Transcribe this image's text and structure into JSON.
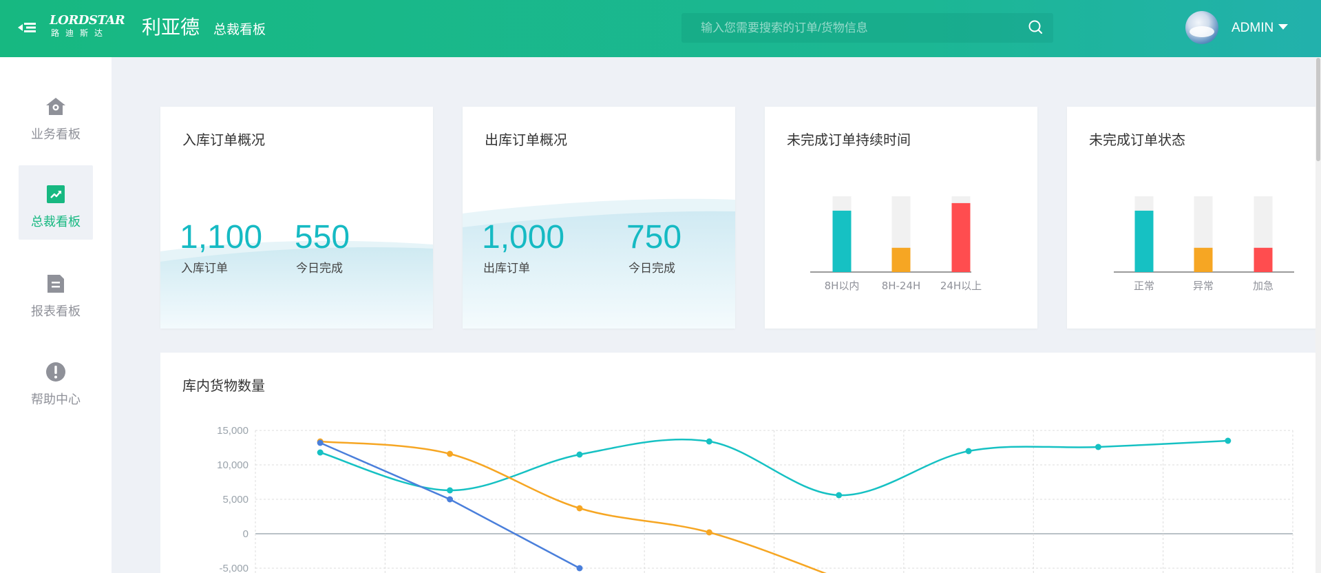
{
  "header": {
    "logo_en": "LORDSTAR",
    "logo_cn": "路迪斯达",
    "brand": "利亚德",
    "subtitle": "总裁看板",
    "search_placeholder": "输入您需要搜索的订单/货物信息",
    "user": "ADMIN"
  },
  "sidebar": {
    "items": [
      {
        "label": "业务看板",
        "icon": "home-location-icon",
        "active": false
      },
      {
        "label": "总裁看板",
        "icon": "trend-chart-icon",
        "active": true
      },
      {
        "label": "报表看板",
        "icon": "report-icon",
        "active": false
      },
      {
        "label": "帮助中心",
        "icon": "help-icon",
        "active": false
      }
    ]
  },
  "cards": {
    "inbound": {
      "title": "入库订单概况",
      "total": "1,100",
      "total_label": "入库订单",
      "today": "550",
      "today_label": "今日完成"
    },
    "outbound": {
      "title": "出库订单概况",
      "total": "1,000",
      "total_label": "出库订单",
      "today": "750",
      "today_label": "今日完成"
    },
    "duration": {
      "title": "未完成订单持续时间"
    },
    "status": {
      "title": "未完成订单状态"
    }
  },
  "colors": {
    "primary": "#17b881",
    "teal": "#16c1c3",
    "orange": "#f6a623",
    "red": "#ff4d4f",
    "blue": "#4a7fdb",
    "track": "#f1f1f1"
  },
  "chart_data": [
    {
      "type": "bar",
      "title": "",
      "categories": [
        "8H以内",
        "8H-24H",
        "24H以上"
      ],
      "values": [
        0.81,
        0.32,
        0.91
      ],
      "colors": [
        "#16c1c3",
        "#f6a623",
        "#ff4d4f"
      ],
      "ylim": [
        0,
        1
      ],
      "grid": false
    },
    {
      "type": "bar",
      "title": "",
      "categories": [
        "正常",
        "异常",
        "加急"
      ],
      "values": [
        0.81,
        0.32,
        0.32
      ],
      "colors": [
        "#16c1c3",
        "#f6a623",
        "#ff4d4f"
      ],
      "ylim": [
        0,
        1
      ],
      "grid": false
    },
    {
      "type": "line",
      "title": "库内货物数量",
      "ylim": [
        -5000,
        15000
      ],
      "yticks": [
        "15,000",
        "10,000",
        "5,000",
        "0",
        "-5,000"
      ],
      "ytick_values": [
        15000,
        10000,
        5000,
        0,
        -5000
      ],
      "grid": true,
      "x": [
        1,
        2,
        3,
        4,
        5,
        6,
        7,
        8
      ],
      "series": [
        {
          "color": "#16c1c3",
          "values": [
            11800,
            6300,
            11500,
            13400,
            5600,
            12000,
            12600,
            13500
          ]
        },
        {
          "color": "#f6a623",
          "values": [
            13400,
            11600,
            3700,
            200,
            -6500,
            null,
            null,
            null
          ]
        },
        {
          "color": "#4a7fdb",
          "values": [
            13200,
            5000,
            -5000,
            null,
            null,
            null,
            null,
            null
          ]
        }
      ]
    }
  ]
}
